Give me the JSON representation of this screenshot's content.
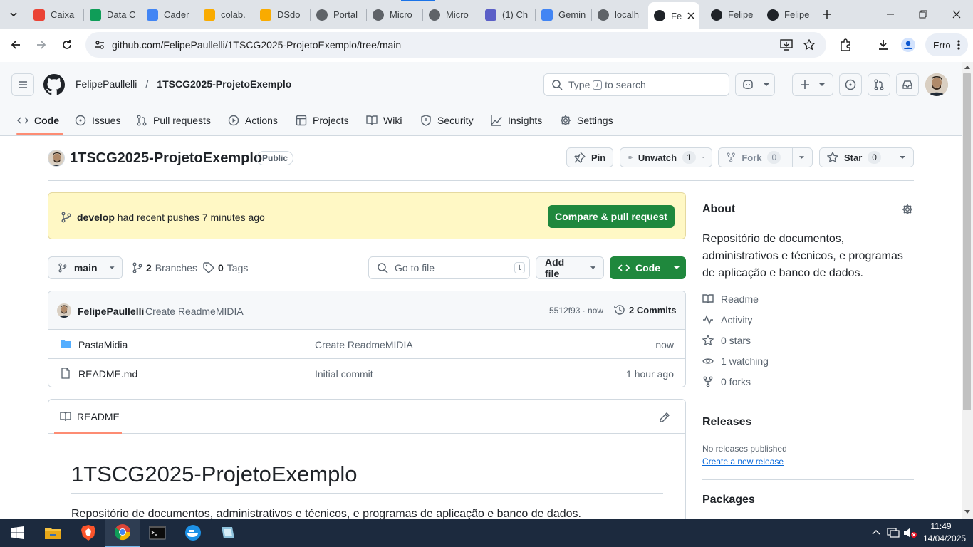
{
  "browser": {
    "tabs": [
      {
        "label": "Caixa",
        "icon": "gmail-icon",
        "color": "#ea4335"
      },
      {
        "label": "Data C",
        "icon": "drive-icon",
        "color": "#0f9d58"
      },
      {
        "label": "Cader",
        "icon": "docs-icon",
        "color": "#4285f4"
      },
      {
        "label": "colab.",
        "icon": "colab-icon",
        "color": "#f9ab00"
      },
      {
        "label": "DSdo",
        "icon": "colab-icon",
        "color": "#f9ab00"
      },
      {
        "label": "Portal",
        "icon": "globe-icon",
        "color": "#5f6368"
      },
      {
        "label": "Micro",
        "icon": "globe-icon",
        "color": "#5f6368"
      },
      {
        "label": "Micro",
        "icon": "globe-icon",
        "color": "#5f6368"
      },
      {
        "label": "(1) Ch",
        "icon": "teams-icon",
        "color": "#5b5fc7"
      },
      {
        "label": "Gemin",
        "icon": "gemini-icon",
        "color": "#4285f4"
      },
      {
        "label": "localh",
        "icon": "globe-icon",
        "color": "#5f6368"
      },
      {
        "label": "Fe",
        "icon": "github-icon",
        "color": "#1f2328"
      },
      {
        "label": "Felipe",
        "icon": "github-icon",
        "color": "#1f2328"
      },
      {
        "label": "Felipe",
        "icon": "github-icon",
        "color": "#1f2328"
      }
    ],
    "url": "github.com/FelipePaullelli/1TSCG2025-ProjetoExemplo/tree/main",
    "profile_label": "Erro"
  },
  "github": {
    "owner": "FelipePaullelli",
    "separator": "/",
    "repo": "1TSCG2025-ProjetoExemplo",
    "search_prefix": "Type",
    "search_key": "/",
    "search_suffix": "to search",
    "nav": [
      "Code",
      "Issues",
      "Pull requests",
      "Actions",
      "Projects",
      "Wiki",
      "Security",
      "Insights",
      "Settings"
    ],
    "visibility": "Public",
    "pin_label": "Pin",
    "unwatch_label": "Unwatch",
    "unwatch_count": "1",
    "fork_label": "Fork",
    "fork_count": "0",
    "star_label": "Star",
    "star_count": "0",
    "banner": {
      "branch": "develop",
      "text": "had recent pushes 7 minutes ago",
      "button": "Compare & pull request"
    },
    "branch_selector": "main",
    "branches_count": "2",
    "branches_label": "Branches",
    "tags_count": "0",
    "tags_label": "Tags",
    "goto_placeholder": "Go to file",
    "goto_key": "t",
    "add_file": "Add file",
    "code_button": "Code",
    "commit": {
      "author": "FelipePaullelli",
      "message": "Create ReadmeMIDIA",
      "hash_time": "5512f93 · now",
      "commits": "2 Commits"
    },
    "files": [
      {
        "name": "PastaMidia",
        "type": "folder",
        "message": "Create ReadmeMIDIA",
        "time": "now"
      },
      {
        "name": "README.md",
        "type": "file",
        "message": "Initial commit",
        "time": "1 hour ago"
      }
    ],
    "readme_tab": "README",
    "readme_title": "1TSCG2025-ProjetoExemplo",
    "readme_body": "Repositório de documentos, administrativos e técnicos, e programas de aplicação e banco de dados.",
    "about": {
      "title": "About",
      "description": "Repositório de documentos, administrativos e técnicos, e programas de aplicação e banco de dados.",
      "readme": "Readme",
      "activity": "Activity",
      "stars": "0 stars",
      "watching": "1 watching",
      "forks": "0 forks"
    },
    "releases": {
      "title": "Releases",
      "none": "No releases published",
      "create": "Create a new release"
    },
    "packages_title": "Packages"
  },
  "taskbar": {
    "time": "11:49",
    "date": "14/04/2025"
  }
}
